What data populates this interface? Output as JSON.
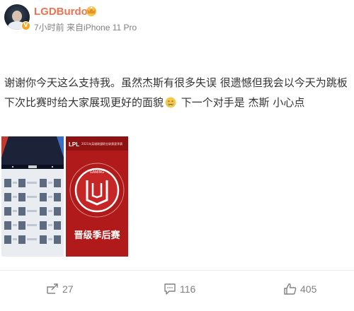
{
  "post": {
    "username": "LGDBurdol",
    "time": "7小时前",
    "source": "来自iPhone 11 Pro",
    "text_part1": "谢谢你今天这么支持我。虽然杰斯有很多失误 很遗憾但我会以今天为跳板 下次比赛时给大家展现更好的面貌",
    "text_part2": " 下一个对手是 杰斯 小心点"
  },
  "images": {
    "image2": {
      "top_label": "2021年英雄联盟职业联赛夏季赛",
      "logo_text": "LPL",
      "brand": "GAMING",
      "bottom_label": "晋级季后赛"
    }
  },
  "actions": {
    "repost_count": "27",
    "comment_count": "116",
    "like_count": "405"
  },
  "colors": {
    "username": "#eb7350",
    "meta": "#808080",
    "image2_bg": "#b01a1a"
  }
}
